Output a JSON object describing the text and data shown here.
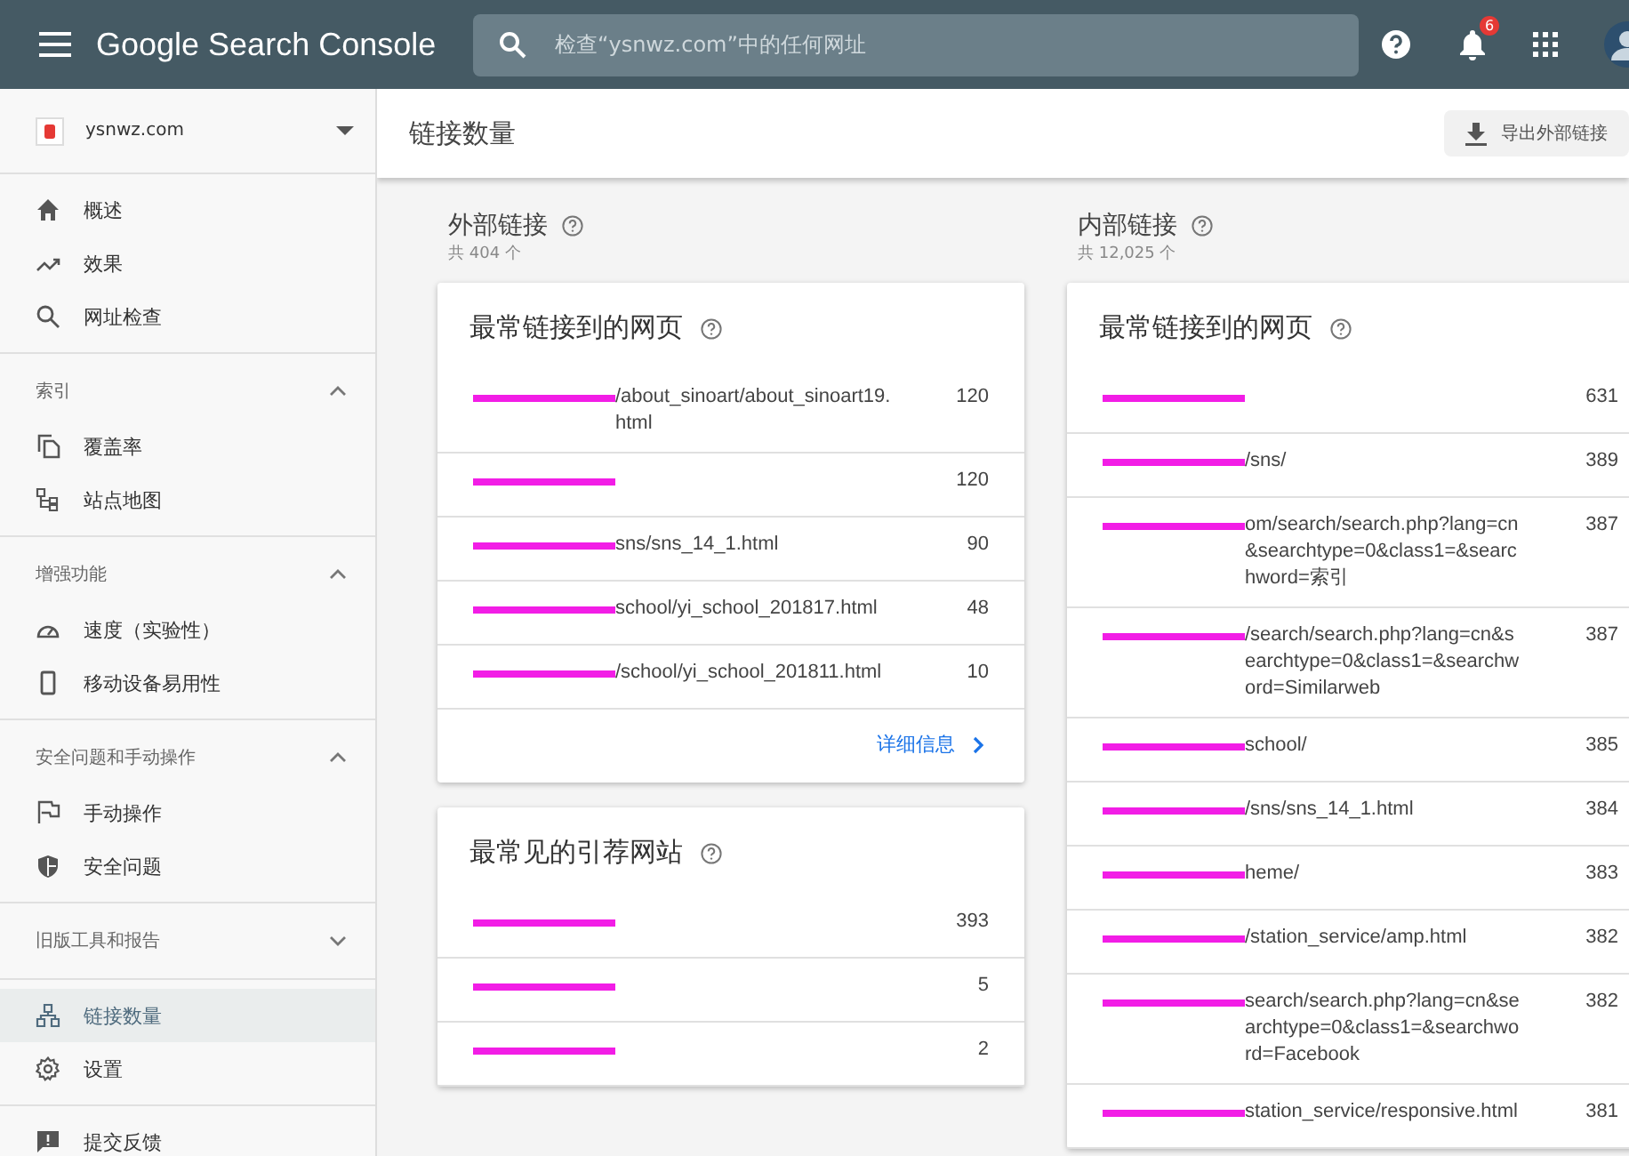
{
  "topbar": {
    "product": "Google Search Console",
    "search": {
      "placeholder": "检查“ysnwz.com”中的任何网址"
    },
    "notification_count": "6"
  },
  "sidebar": {
    "property": "ysnwz.com",
    "groups": [
      {
        "items": [
          {
            "label": "概述",
            "selected": false
          },
          {
            "label": "效果",
            "selected": false
          },
          {
            "label": "网址检查",
            "selected": false
          }
        ]
      },
      {
        "title": "索引",
        "expanded": true,
        "items": [
          {
            "label": "覆盖率",
            "selected": false
          },
          {
            "label": "站点地图",
            "selected": false
          }
        ]
      },
      {
        "title": "增强功能",
        "expanded": true,
        "items": [
          {
            "label": "速度（实验性）",
            "selected": false
          },
          {
            "label": "移动设备易用性",
            "selected": false
          }
        ]
      },
      {
        "title": "安全问题和手动操作",
        "expanded": true,
        "items": [
          {
            "label": "手动操作",
            "selected": false
          },
          {
            "label": "安全问题",
            "selected": false
          }
        ]
      },
      {
        "title": "旧版工具和报告",
        "expanded": false
      },
      {
        "items": [
          {
            "label": "链接数量",
            "selected": true
          },
          {
            "label": "设置",
            "selected": false
          }
        ]
      },
      {
        "items": [
          {
            "label": "提交反馈",
            "selected": false
          }
        ]
      }
    ]
  },
  "page": {
    "title": "链接数量",
    "export_button": "导出外部链接"
  },
  "columns": [
    {
      "title": "外部链接",
      "total": "共 404 个",
      "cards": [
        {
          "title": "最常链接到的网页",
          "rows": [
            {
              "redacted": true,
              "url": "/about_sinoart/about_sinoart19.html",
              "count": "120"
            },
            {
              "redacted": true,
              "count": "120"
            },
            {
              "redacted": true,
              "url": "sns/sns_14_1.html",
              "count": "90"
            },
            {
              "redacted": true,
              "url": "school/yi_school_201817.html",
              "count": "48"
            },
            {
              "redacted": true,
              "url": "/school/yi_school_201811.html",
              "count": "10"
            }
          ],
          "details_link": "详细信息"
        },
        {
          "title": "最常见的引荐网站",
          "rows": [
            {
              "redacted": true,
              "count": "393"
            },
            {
              "redacted": true,
              "count": "5"
            },
            {
              "redacted": true,
              "count": "2"
            }
          ]
        }
      ]
    },
    {
      "title": "内部链接",
      "total": "共 12,025 个",
      "cards": [
        {
          "title": "最常链接到的网页",
          "rows": [
            {
              "redacted": true,
              "count": "631"
            },
            {
              "redacted": true,
              "url": "/sns/",
              "count": "389"
            },
            {
              "redacted": true,
              "url": "om/search/search.php?lang=cn&searchtype=0&class1=&searchword=索引",
              "count": "387"
            },
            {
              "redacted": true,
              "url": "/search/search.php?lang=cn&searchtype=0&class1=&searchword=Similarweb",
              "count": "387"
            },
            {
              "redacted": true,
              "url": "school/",
              "count": "385"
            },
            {
              "redacted": true,
              "url": "/sns/sns_14_1.html",
              "count": "384"
            },
            {
              "redacted": true,
              "url": "heme/",
              "count": "383"
            },
            {
              "redacted": true,
              "url": "/station_service/amp.html",
              "count": "382"
            },
            {
              "redacted": true,
              "url": "search/search.php?lang=cn&searchtype=0&class1=&searchword=Facebook",
              "count": "382"
            },
            {
              "redacted": true,
              "url": "station_service/responsive.html",
              "count": "381"
            }
          ]
        }
      ]
    }
  ]
}
